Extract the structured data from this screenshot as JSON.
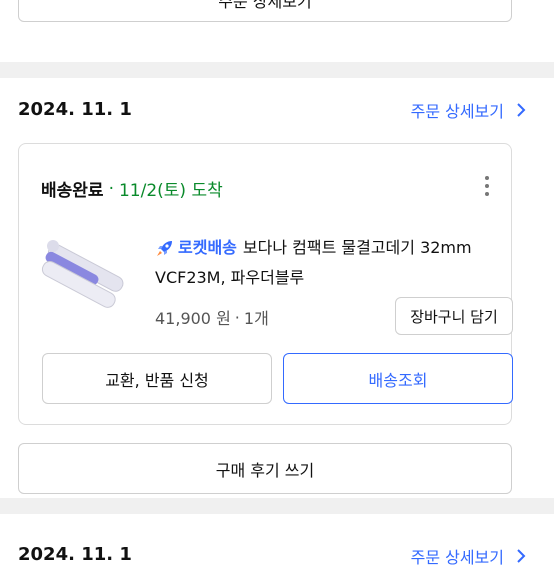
{
  "top_section": {
    "button_label": "주문 상세보기"
  },
  "order": {
    "date": "2024. 11. 1",
    "detail_link": "주문 상세보기",
    "status": "배송완료",
    "separator": "·",
    "arrival": "11/2(토) 도착",
    "product": {
      "badge": "로켓배송",
      "name_line1": "보다나 컴팩트 물결고데기 32mm",
      "name_line2": "VCF23M, 파우더블루",
      "price": "41,900 원",
      "dot": "·",
      "quantity": "1개",
      "cart_button": "장바구니 담기"
    },
    "exchange_button": "교환, 반품 신청",
    "track_button": "배송조회",
    "review_button": "구매 후기 쓰기"
  },
  "next_order": {
    "date": "2024. 11. 1",
    "detail_link": "주문 상세보기"
  },
  "colors": {
    "link": "#346aff",
    "status_green": "#0a8a2b",
    "divider": "#f0f0f0"
  },
  "icons": [
    "chevron-right-icon",
    "more-vertical-icon",
    "rocket-icon"
  ]
}
